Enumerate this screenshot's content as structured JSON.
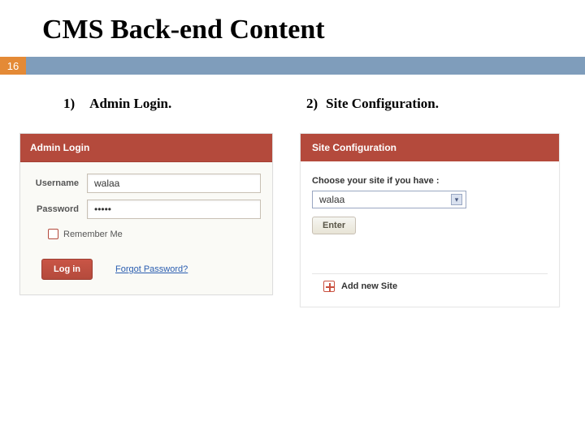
{
  "slide": {
    "title": "CMS Back-end Content",
    "page_number": "16"
  },
  "col1": {
    "index": "1)",
    "heading": "Admin Login.",
    "panel_title": "Admin Login",
    "username_label": "Username",
    "username_value": "walaa",
    "password_label": "Password",
    "password_value": "•••••",
    "remember_label": "Remember Me",
    "login_button": "Log in",
    "forgot_link": "Forgot Password?"
  },
  "col2": {
    "index": "2)",
    "heading": "Site Configuration.",
    "panel_title": "Site Configuration",
    "choose_label": "Choose your site if you have :",
    "selected_site": "walaa",
    "enter_button": "Enter",
    "add_site": "Add new Site"
  }
}
